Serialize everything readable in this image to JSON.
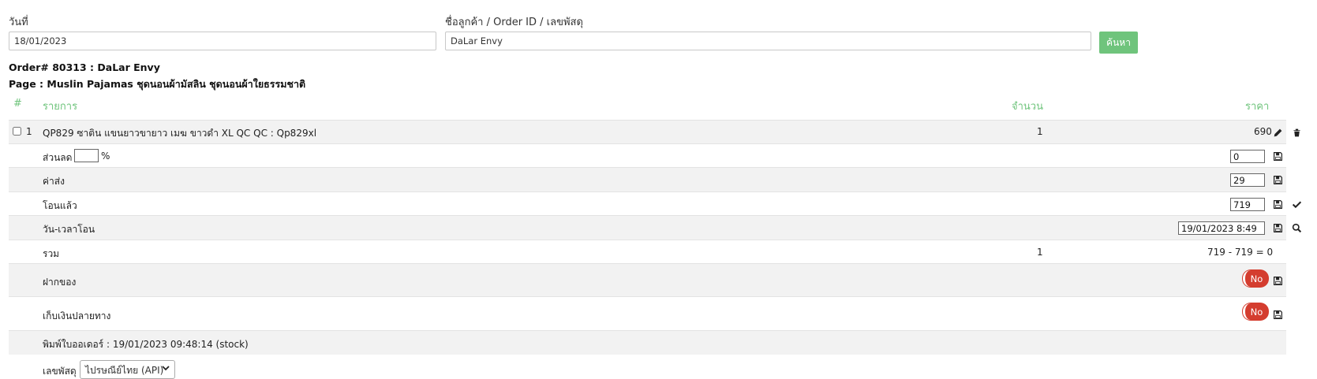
{
  "filters": {
    "date_label": "วันที่",
    "date_value": "18/01/2023",
    "customer_label": "ชื่อลูกค้า / Order ID / เลขพัสดุ",
    "customer_value": "DaLar Envy",
    "search_label": "ค้นหา"
  },
  "order": {
    "title": "Order# 80313 : DaLar Envy",
    "page": "Page : Muslin Pajamas ชุดนอนผ้ามัสลิน ชุดนอนผ้าใยธรรมชาติ"
  },
  "table": {
    "headers": {
      "index": "#",
      "item": "รายการ",
      "qty": "จำนวน",
      "price": "ราคา"
    },
    "item": {
      "index": "1",
      "name": "QP829 ซาติน แขนยาวขายาว เมฆ ขาวดำ XL QC QC : Qp829xl",
      "qty": "1",
      "price": "690"
    },
    "discount": {
      "label": "ส่วนลด",
      "unit": "%",
      "value": "0"
    },
    "shipping": {
      "label": "ค่าส่ง",
      "value": "29"
    },
    "transferred": {
      "label": "โอนแล้ว",
      "value": "719"
    },
    "transfer_time": {
      "label": "วัน-เวลาโอน",
      "value": "19/01/2023 8:49"
    },
    "total": {
      "label": "รวม",
      "qty": "1",
      "value": "719 - 719 = 0"
    },
    "deposit": {
      "label": "ฝากของ",
      "toggle": "No"
    },
    "cod": {
      "label": "เก็บเงินปลายทาง",
      "toggle": "No"
    },
    "printed": "พิมพ์ใบออเดอร์ : 19/01/2023 09:48:14 (stock)",
    "tracking": {
      "label": "เลขพัสดุ",
      "selected": "ไปรษณีย์ไทย (API)"
    }
  },
  "colors": {
    "accent": "#6fc47c",
    "toggle_off": "#d43d2f"
  },
  "icons": [
    "pencil-icon",
    "trash-icon",
    "save-icon",
    "check-icon",
    "search-icon",
    "chevron-down-icon"
  ]
}
